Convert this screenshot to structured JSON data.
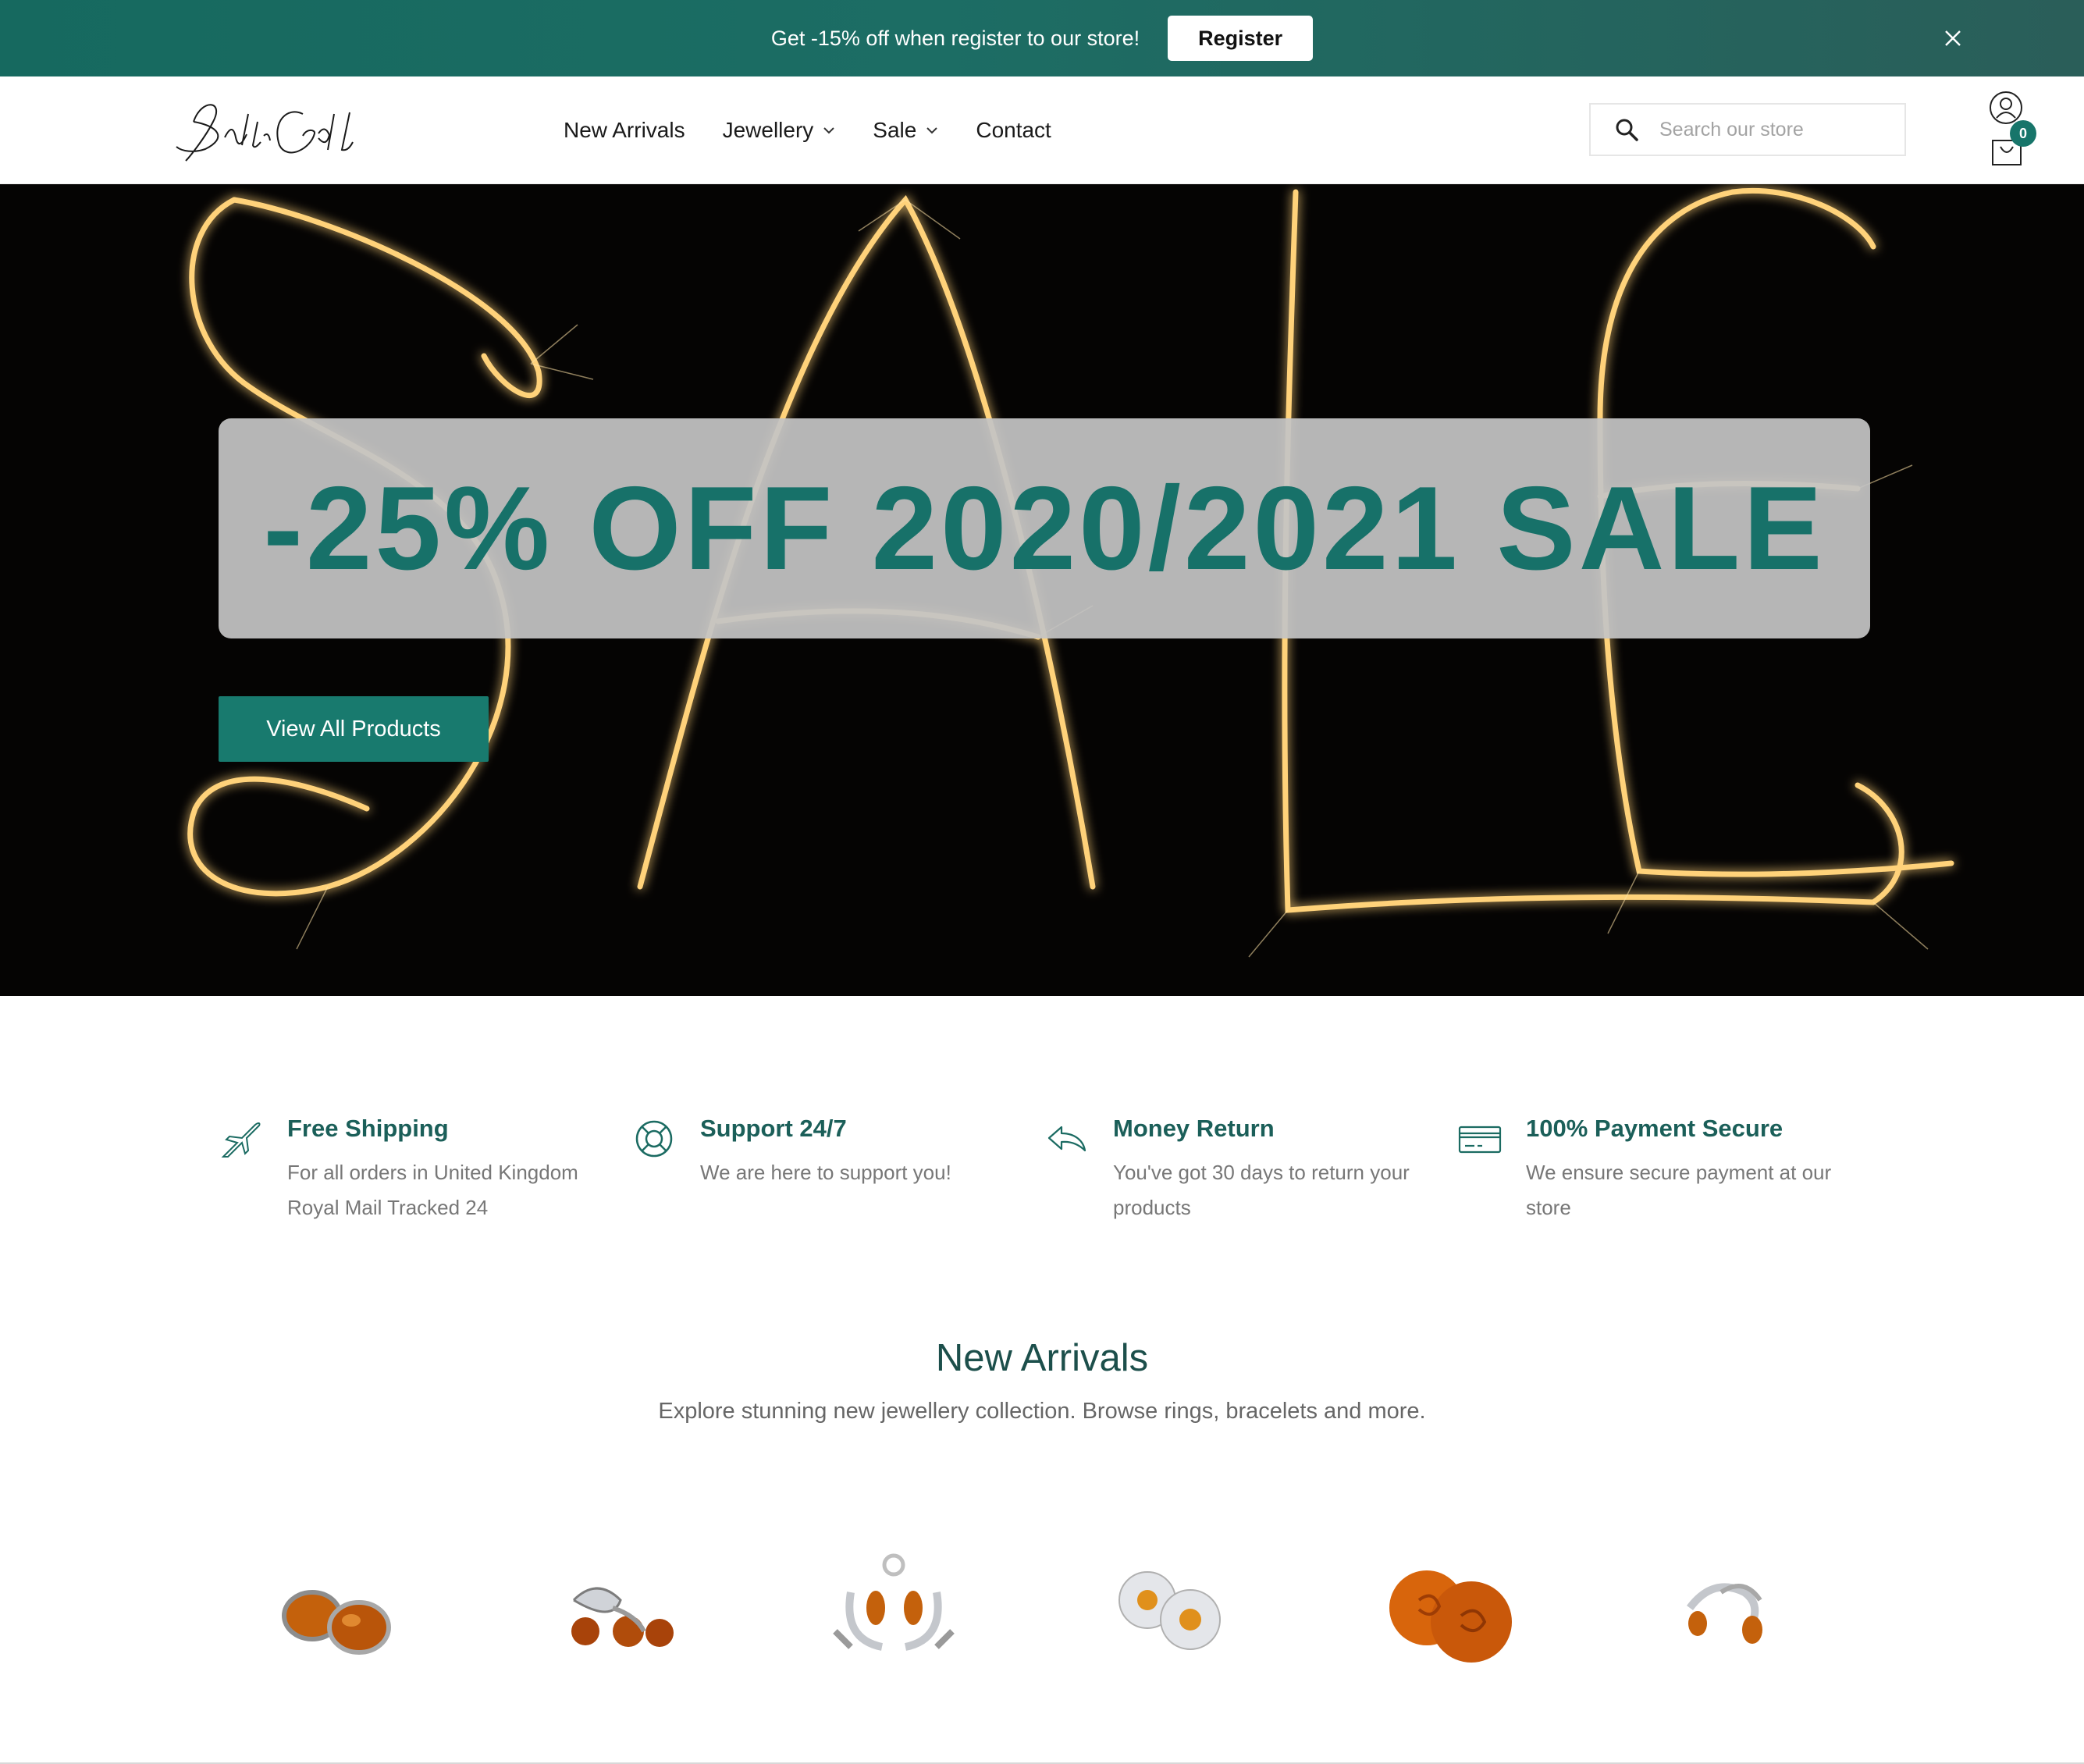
{
  "promo": {
    "text": "Get -15% off when register to our store!",
    "button_label": "Register"
  },
  "header": {
    "logo_text": "BalticGold",
    "nav": [
      {
        "label": "New Arrivals",
        "has_dropdown": false
      },
      {
        "label": "Jewellery",
        "has_dropdown": true
      },
      {
        "label": "Sale",
        "has_dropdown": true
      },
      {
        "label": "Contact",
        "has_dropdown": false
      }
    ],
    "search_placeholder": "Search our store",
    "cart_count": "0"
  },
  "hero": {
    "title": "-25% OFF 2020/2021 SALE",
    "cta_label": "View All Products"
  },
  "features": [
    {
      "icon": "airplane-icon",
      "title": "Free Shipping",
      "desc": "For all orders in United Kingdom Royal Mail Tracked 24"
    },
    {
      "icon": "lifebuoy-icon",
      "title": "Support 24/7",
      "desc": "We are here to support you!"
    },
    {
      "icon": "return-arrow-icon",
      "title": "Money Return",
      "desc": "You've got 30 days to return your products"
    },
    {
      "icon": "credit-card-icon",
      "title": "100% Payment Secure",
      "desc": "We ensure secure payment at our store"
    }
  ],
  "new_arrivals": {
    "title": "New Arrivals",
    "subtitle": "Explore stunning new jewellery collection. Browse rings, bracelets and more."
  },
  "colors": {
    "brand": "#187a6e",
    "amber": "#c4610c",
    "silver": "#c9ccd1"
  }
}
